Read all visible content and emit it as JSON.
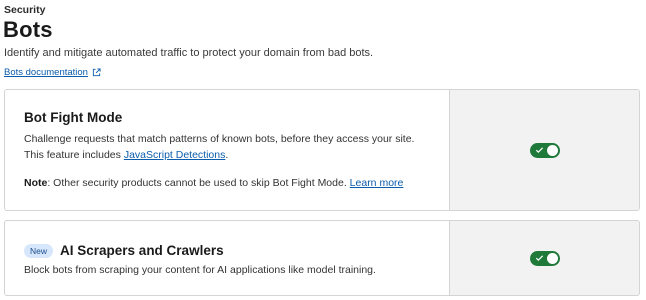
{
  "header": {
    "eyebrow": "Security",
    "title": "Bots",
    "subtitle": "Identify and mitigate automated traffic to protect your domain from bad bots.",
    "doc_link": "Bots documentation",
    "doc_link_icon": "external-link-icon"
  },
  "cards": [
    {
      "title": "Bot Fight Mode",
      "desc_text": "Challenge requests that match patterns of known bots, before they access your site. This feature includes ",
      "desc_link": "JavaScript Detections",
      "desc_end": ".",
      "note_label": "Note",
      "note_text": ": Other security products cannot be used to skip Bot Fight Mode. ",
      "note_link": "Learn more",
      "toggle_on": true
    },
    {
      "badge": "New",
      "title": "AI Scrapers and Crawlers",
      "desc_text": "Block bots from scraping your content for AI applications like model training.",
      "toggle_on": true
    }
  ],
  "colors": {
    "toggle_on": "#1f7a3a",
    "link": "#0b5cad",
    "badge_bg": "#d6e6fb",
    "side_panel_bg": "#f2f2f2"
  }
}
